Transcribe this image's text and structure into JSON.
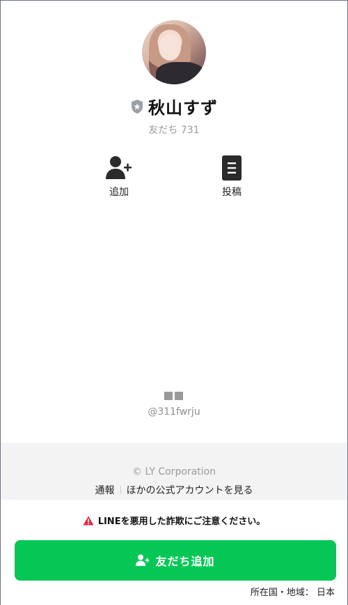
{
  "profile": {
    "name": "秋山すず",
    "friends_label": "友だち 731"
  },
  "actions": {
    "add_label": "追加",
    "post_label": "投稿"
  },
  "account": {
    "handle": "@311fwrju"
  },
  "footer": {
    "copyright": "© LY Corporation",
    "report_label": "通報",
    "other_accounts_label": "ほかの公式アカウントを見る"
  },
  "warning": {
    "text": "LINEを悪用した詐欺にご注意ください。"
  },
  "cta": {
    "label": "友だち追加"
  },
  "region": {
    "text": "所在国・地域： 日本"
  },
  "colors": {
    "accent": "#06c755",
    "warning": "#e5274a",
    "badge": "#9aa0a6"
  },
  "icons": {
    "badge": "shield-star-icon",
    "add": "person-add-icon",
    "post": "document-icon",
    "qr": "qr-code-icon",
    "warning": "warning-triangle-icon",
    "cta": "person-add-icon"
  }
}
